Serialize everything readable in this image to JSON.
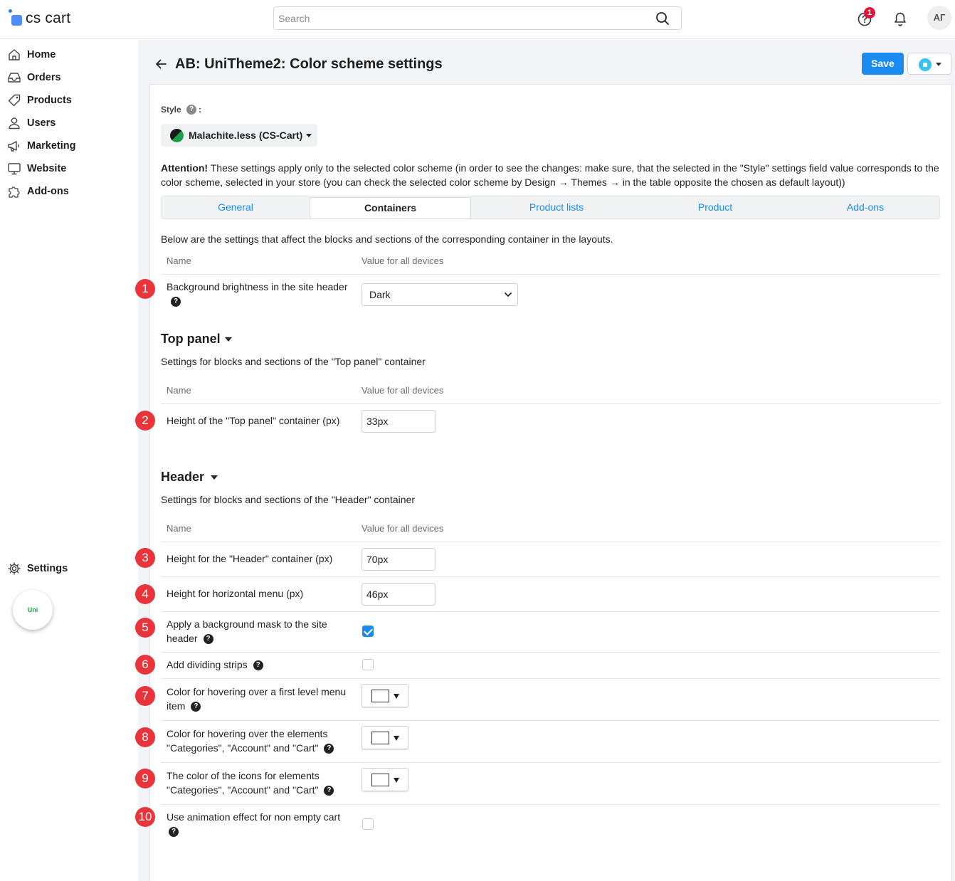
{
  "header": {
    "logo_text": "cs cart",
    "search_placeholder": "Search",
    "help_badge": "1",
    "avatar_initials": "АГ"
  },
  "sidebar": {
    "items": [
      {
        "label": "Home",
        "icon": "home-icon"
      },
      {
        "label": "Orders",
        "icon": "inbox-icon"
      },
      {
        "label": "Products",
        "icon": "tag-icon"
      },
      {
        "label": "Users",
        "icon": "user-icon"
      },
      {
        "label": "Marketing",
        "icon": "megaphone-icon"
      },
      {
        "label": "Website",
        "icon": "monitor-icon"
      },
      {
        "label": "Add-ons",
        "icon": "puzzle-icon"
      }
    ],
    "settings_label": "Settings",
    "uni_label": "Uni"
  },
  "page": {
    "title": "AB: UniTheme2: Color scheme settings",
    "save_label": "Save",
    "style_label": "Style",
    "style_value": "Malachite.less (CS-Cart)",
    "attention_bold": "Attention!",
    "attention_text": " These settings apply only to the selected color scheme (in order to see the changes: make sure, that the selected in the \"Style\" settings field value corresponds to the color scheme, selected in your store (you can check the selected color scheme by Design → Themes → in the table opposite the chosen as default layout))",
    "tabs": [
      {
        "label": "General",
        "active": false
      },
      {
        "label": "Containers",
        "active": true
      },
      {
        "label": "Product lists",
        "active": false
      },
      {
        "label": "Product",
        "active": false
      },
      {
        "label": "Add-ons",
        "active": false
      }
    ],
    "intro": "Below are the settings that affect the blocks and sections of the corresponding container in the layouts.",
    "col_name": "Name",
    "col_value": "Value for all devices"
  },
  "general_section": {
    "rows": [
      {
        "num": "1",
        "label": "Background brightness in the site header",
        "value": "Dark"
      }
    ]
  },
  "top_panel": {
    "title": "Top panel",
    "desc": "Settings for blocks and sections of the \"Top panel\" container",
    "rows": [
      {
        "num": "2",
        "label": "Height of the \"Top panel\" container (px)",
        "value": "33px"
      }
    ]
  },
  "header_section": {
    "title": "Header",
    "desc": "Settings for blocks and sections of the \"Header\" container",
    "rows": [
      {
        "num": "3",
        "label": "Height for the \"Header\" container (px)",
        "value": "70px"
      },
      {
        "num": "4",
        "label": "Height for horizontal menu (px)",
        "value": "46px"
      },
      {
        "num": "5",
        "label": "Apply a background mask to the site header",
        "checked": true
      },
      {
        "num": "6",
        "label": "Add dividing strips",
        "checked": false
      },
      {
        "num": "7",
        "label": "Color for hovering over a first level menu item",
        "color": "#ffffff"
      },
      {
        "num": "8",
        "label": "Color for hovering over the elements \"Categories\", \"Account\" and \"Cart\"",
        "color": "#ffffff"
      },
      {
        "num": "9",
        "label": "The color of the icons for elements \"Categories\", \"Account\" and \"Cart\"",
        "color": "#ffffff"
      },
      {
        "num": "10",
        "label": "Use animation effect for non empty cart",
        "checked": false
      }
    ]
  },
  "colors": {
    "accent": "#1a8cf0",
    "badge_red": "#e8343a",
    "help_badge": "#e0143c",
    "malachite_green": "#19a24a"
  }
}
